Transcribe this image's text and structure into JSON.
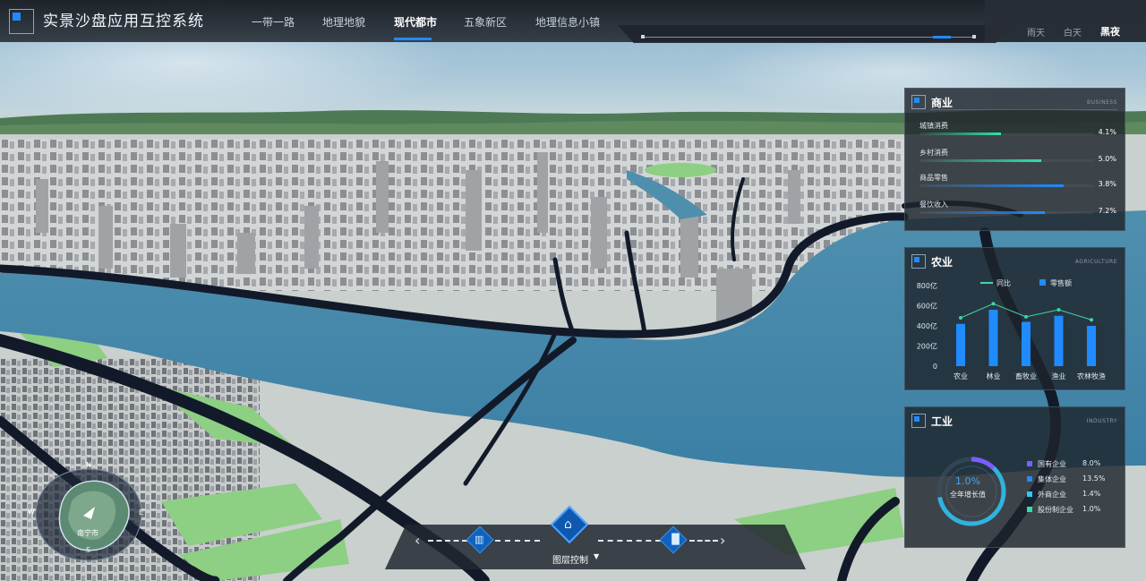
{
  "app": {
    "title": "实景沙盘应用互控系统"
  },
  "nav": {
    "items": [
      {
        "label": "一带一路"
      },
      {
        "label": "地理地貌"
      },
      {
        "label": "现代都市"
      },
      {
        "label": "五象新区"
      },
      {
        "label": "地理信息小镇"
      }
    ],
    "active": "现代都市"
  },
  "weather_modes": {
    "items": [
      {
        "label": "雨天"
      },
      {
        "label": "白天"
      },
      {
        "label": "黑夜"
      }
    ],
    "active": "黑夜"
  },
  "business": {
    "title": "商业",
    "subtitle": "BUSINESS",
    "rows": [
      {
        "label": "城镇消费",
        "value": "4.1%",
        "fraction": 0.47,
        "color": "#2fe0b0"
      },
      {
        "label": "乡村消费",
        "value": "5.0%",
        "fraction": 0.7,
        "color": "#2fe0b0"
      },
      {
        "label": "商品零售",
        "value": "3.8%",
        "fraction": 0.83,
        "color": "#1f8bff"
      },
      {
        "label": "餐饮收入",
        "value": "7.2%",
        "fraction": 0.72,
        "color": "#1f8bff"
      }
    ]
  },
  "agriculture": {
    "title": "农业",
    "subtitle": "AGRICULTURE",
    "legend": {
      "line": "同比",
      "bar": "零售额"
    },
    "chart_data": {
      "type": "bar",
      "categories": [
        "农业",
        "林业",
        "畜牧业",
        "渔业",
        "农林牧渔"
      ],
      "series": [
        {
          "name": "零售额",
          "values": [
            420,
            560,
            440,
            500,
            400
          ]
        },
        {
          "name": "同比",
          "values": [
            480,
            620,
            490,
            560,
            460
          ]
        }
      ],
      "y_ticks": [
        "800亿",
        "600亿",
        "400亿",
        "200亿",
        "0"
      ],
      "ylim": [
        0,
        800
      ],
      "bar_color": "#1f8bff",
      "line_color": "#3fd6a4"
    }
  },
  "industry": {
    "title": "工业",
    "subtitle": "INDUSTRY",
    "ring_value": "1.0%",
    "ring_label": "全年增长值",
    "ring_fraction": 0.72,
    "legend": [
      {
        "label": "国有企业",
        "value": "8.0%",
        "color": "#7b5cff"
      },
      {
        "label": "集体企业",
        "value": "13.5%",
        "color": "#1f8bff"
      },
      {
        "label": "外商企业",
        "value": "1.4%",
        "color": "#2fc6ff"
      },
      {
        "label": "股份制企业",
        "value": "1.0%",
        "color": "#2fe0b0"
      }
    ]
  },
  "layer_control": {
    "label": "图层控制"
  },
  "minimap": {
    "city": "南宁市",
    "n": "N",
    "s": "S",
    "e": "E",
    "w": "W"
  }
}
